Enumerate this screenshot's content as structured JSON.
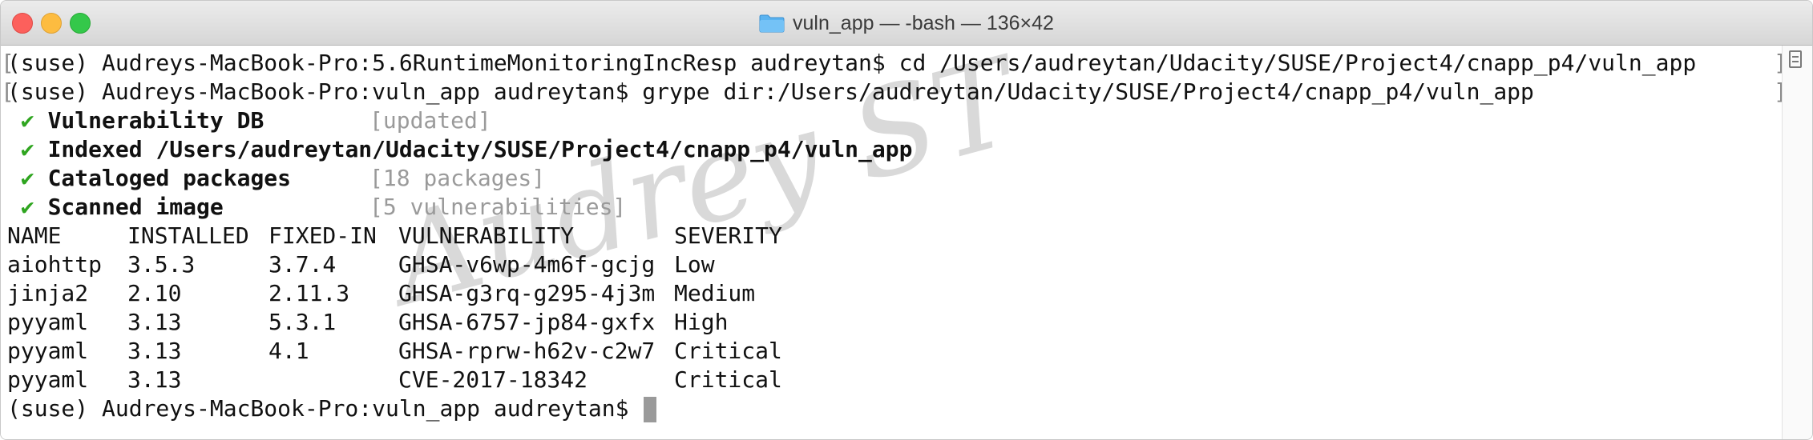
{
  "window": {
    "title": "vuln_app — -bash — 136×42"
  },
  "terminal": {
    "line1": "(suse) Audreys-MacBook-Pro:5.6RuntimeMonitoringIncResp audreytan$ cd /Users/audreytan/Udacity/SUSE/Project4/cnapp_p4/vuln_app",
    "line2": "(suse) Audreys-MacBook-Pro:vuln_app audreytan$ grype dir:/Users/audreytan/Udacity/SUSE/Project4/cnapp_p4/vuln_app",
    "steps": [
      {
        "check": "✔",
        "label": "Vulnerability DB",
        "status": "[updated]"
      },
      {
        "check": "✔",
        "label": "Indexed /Users/audreytan/Udacity/SUSE/Project4/cnapp_p4/vuln_app",
        "status": ""
      },
      {
        "check": "✔",
        "label": "Cataloged packages",
        "status": "[18 packages]"
      },
      {
        "check": "✔",
        "label": "Scanned image",
        "status": "[5 vulnerabilities]"
      }
    ],
    "table": {
      "headers": [
        "NAME",
        "INSTALLED",
        "FIXED-IN",
        "VULNERABILITY",
        "SEVERITY"
      ],
      "rows": [
        [
          "aiohttp",
          "3.5.3",
          "3.7.4",
          "GHSA-v6wp-4m6f-gcjg",
          "Low"
        ],
        [
          "jinja2",
          "2.10",
          "2.11.3",
          "GHSA-g3rq-g295-4j3m",
          "Medium"
        ],
        [
          "pyyaml",
          "3.13",
          "5.3.1",
          "GHSA-6757-jp84-gxfx",
          "High"
        ],
        [
          "pyyaml",
          "3.13",
          "4.1",
          "GHSA-rprw-h62v-c2w7",
          "Critical"
        ],
        [
          "pyyaml",
          "3.13",
          "",
          "CVE-2017-18342",
          "Critical"
        ]
      ]
    },
    "prompt": "(suse) Audreys-MacBook-Pro:vuln_app audreytan$ ",
    "watermark": "Audrey ST"
  },
  "colors": {
    "check": "#2fa520",
    "dim_text": "#9a9a9a",
    "text": "#111111",
    "close": "#fc605c",
    "minimize": "#fdbc40",
    "maximize": "#34c84a"
  },
  "icons": {
    "title_icon": "folder-icon",
    "scroll_icon": "scroll-marker-icon"
  }
}
